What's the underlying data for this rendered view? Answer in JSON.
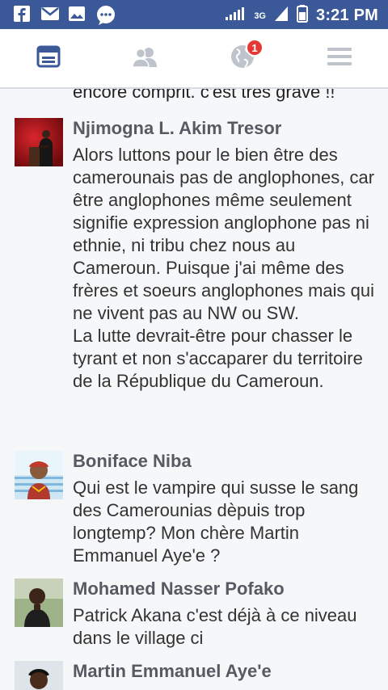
{
  "status_bar": {
    "time": "3:21 PM",
    "network": "3G",
    "icons": [
      "facebook-icon",
      "message-icon",
      "gallery-icon",
      "chat-icon"
    ]
  },
  "nav": {
    "tabs": [
      "news-feed",
      "friends",
      "notifications",
      "menu"
    ],
    "notifications_badge": "1"
  },
  "previous_comment_tail": "encore comprit. c'est tres grave !!",
  "comments": [
    {
      "name": "Njimogna L. Akim Tresor",
      "text": "Alors luttons pour le bien être des camerounais pas de anglophones, car être anglophones même seulement signifie expression anglophone pas ni ethnie, ni tribu chez nous au Cameroun. Puisque j'ai même des frères et soeurs anglophones mais qui ne vivent pas au NW ou SW.\nLa lutte devrait-être pour chasser le tyrant et non s'accaparer du territoire de la République du Cameroun."
    },
    {
      "name": "Boniface Niba",
      "text": "Qui est le vampire qui susse le sang des Camerounias dèpuis trop longtemp? Mon chère Martin Emmanuel Aye'e ?"
    },
    {
      "name": "Mohamed Nasser Pofako",
      "text": "Patrick Akana c'est déjà à ce niveau dans le village ci"
    },
    {
      "name": "Martin Emmanuel Aye'e",
      "text": ""
    }
  ],
  "colors": {
    "status_bar": "#3b5998",
    "nav_icon": "#bfc3cb",
    "nav_icon_active": "#3b5998",
    "badge": "#e53935",
    "name": "#555a63",
    "text": "#333333"
  }
}
